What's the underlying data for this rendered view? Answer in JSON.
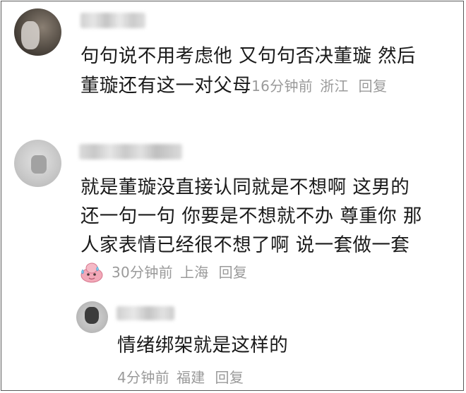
{
  "comments": [
    {
      "lines": [
        "句句说不用考虑他 又句句否决董璇 然后",
        "董璇还有这一对父母"
      ],
      "time": "16分钟前",
      "location": "浙江",
      "reply": "回复"
    },
    {
      "lines": [
        "就是董璇没直接认同就是不想啊 这男的",
        "还一句一句 你要是不想就不办 尊重你 那",
        "人家表情已经很不想了啊 说一套做一套"
      ],
      "time": "30分钟前",
      "location": "上海",
      "reply": "回复"
    },
    {
      "lines": [
        "情绪绑架就是这样的"
      ],
      "time": "4分钟前",
      "location": "福建",
      "reply": "回复"
    }
  ],
  "colors": {
    "text": "#1a1a1a",
    "meta": "#9a9a9a",
    "border": "#5a5a5a"
  },
  "icons": {
    "reaction": "sweaty-pink-face-sticker"
  }
}
